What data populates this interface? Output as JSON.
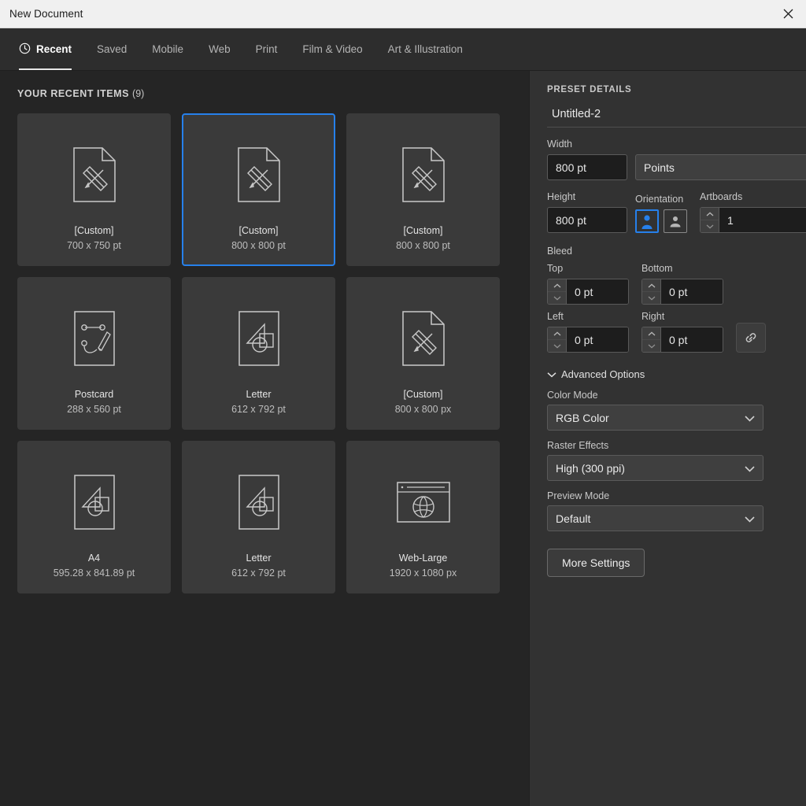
{
  "window": {
    "title": "New Document",
    "close_icon": "close-icon"
  },
  "tabs": [
    {
      "label": "Recent",
      "icon": "clock-icon",
      "active": true
    },
    {
      "label": "Saved",
      "active": false
    },
    {
      "label": "Mobile",
      "active": false
    },
    {
      "label": "Web",
      "active": false
    },
    {
      "label": "Print",
      "active": false
    },
    {
      "label": "Film & Video",
      "active": false
    },
    {
      "label": "Art & Illustration",
      "active": false
    }
  ],
  "recent": {
    "heading": "YOUR RECENT ITEMS",
    "count": "(9)",
    "items": [
      {
        "name": "[Custom]",
        "size": "700 x 750 pt",
        "icon": "document-pencil-ruler-icon",
        "selected": false
      },
      {
        "name": "[Custom]",
        "size": "800 x 800 pt",
        "icon": "document-pencil-ruler-icon",
        "selected": true
      },
      {
        "name": "[Custom]",
        "size": "800 x 800 pt",
        "icon": "document-pencil-ruler-icon",
        "selected": false
      },
      {
        "name": "Postcard",
        "size": "288 x 560 pt",
        "icon": "pen-tool-path-icon",
        "selected": false
      },
      {
        "name": "Letter",
        "size": "612 x 792 pt",
        "icon": "shapes-icon",
        "selected": false
      },
      {
        "name": "[Custom]",
        "size": "800 x 800 px",
        "icon": "document-pencil-ruler-icon",
        "selected": false
      },
      {
        "name": "A4",
        "size": "595.28 x 841.89 pt",
        "icon": "shapes-icon",
        "selected": false
      },
      {
        "name": "Letter",
        "size": "612 x 792 pt",
        "icon": "shapes-icon",
        "selected": false
      },
      {
        "name": "Web-Large",
        "size": "1920 x 1080 px",
        "icon": "browser-globe-icon",
        "selected": false
      }
    ]
  },
  "preset": {
    "panel_title": "PRESET DETAILS",
    "document_name": "Untitled-2",
    "width_label": "Width",
    "width_value": "800 pt",
    "units_value": "Points",
    "height_label": "Height",
    "height_value": "800 pt",
    "orientation_label": "Orientation",
    "orientation_portrait": "portrait-icon",
    "orientation_landscape": "landscape-icon",
    "orientation_selected": "portrait",
    "artboards_label": "Artboards",
    "artboards_value": "1",
    "bleed_label": "Bleed",
    "bleed_top_label": "Top",
    "bleed_top_value": "0 pt",
    "bleed_bottom_label": "Bottom",
    "bleed_bottom_value": "0 pt",
    "bleed_left_label": "Left",
    "bleed_left_value": "0 pt",
    "bleed_right_label": "Right",
    "bleed_right_value": "0 pt",
    "bleed_link_icon": "link-icon",
    "advanced_label": "Advanced Options",
    "advanced_expanded": true,
    "color_mode_label": "Color Mode",
    "color_mode_value": "RGB Color",
    "raster_label": "Raster Effects",
    "raster_value": "High (300 ppi)",
    "preview_label": "Preview Mode",
    "preview_value": "Default",
    "more_settings_label": "More Settings"
  },
  "colors": {
    "accent": "#2680eb",
    "titlebar_bg": "#f0f0f0",
    "tabbar_bg": "#2d2d2d",
    "left_pane_bg": "#252525",
    "right_pane_bg": "#323232",
    "card_bg": "#3a3a3a"
  }
}
